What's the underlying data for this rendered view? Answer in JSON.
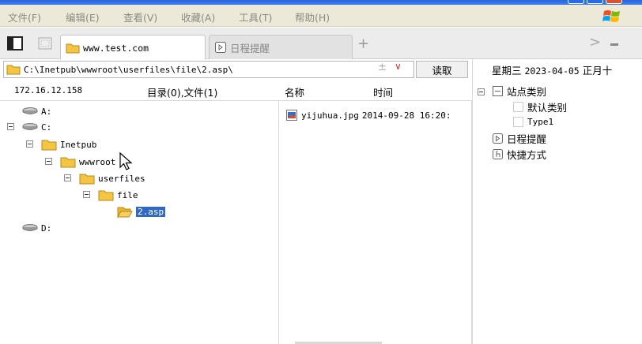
{
  "menu": {
    "items": [
      "文件(F)",
      "编辑(E)",
      "查看(V)",
      "收藏(A)",
      "工具(T)",
      "帮助(H)"
    ]
  },
  "tabs": [
    {
      "label": "www.test.com",
      "icon": "folder-icon",
      "active": true
    },
    {
      "label": "日程提醒",
      "icon": "calendar-icon",
      "active": false
    }
  ],
  "tab_add": "+",
  "address": {
    "path": "C:\\Inetpub\\wwwroot\\userfiles\\file\\2.asp\\",
    "plusminus": "±",
    "dropdown": "∨",
    "read_button": "读取"
  },
  "status": {
    "ip": "172.16.12.158",
    "summary": "目录(0),文件(1)"
  },
  "columns": {
    "name": "名称",
    "time": "时间"
  },
  "tree": [
    {
      "label": "A:",
      "type": "drive"
    },
    {
      "label": "C:",
      "type": "drive"
    },
    {
      "label": "Inetpub",
      "type": "folder"
    },
    {
      "label": "wwwroot",
      "type": "folder"
    },
    {
      "label": "userfiles",
      "type": "folder"
    },
    {
      "label": "file",
      "type": "folder"
    },
    {
      "label": "2.asp",
      "type": "folder-open",
      "selected": true
    },
    {
      "label": "D:",
      "type": "drive"
    }
  ],
  "files": [
    {
      "name": "yijuhua.jpg",
      "time": "2014-09-28 16:20:"
    }
  ],
  "right_panel": {
    "date_weekday": "星期三",
    "date_value": "2023-04-05",
    "date_lunar": "正月十",
    "nodes": [
      {
        "label": "站点类别",
        "icon": "category-icon"
      },
      {
        "label": "默认类别",
        "icon": "dotted-box-icon"
      },
      {
        "label": "Type1",
        "icon": "dotted-box-icon"
      },
      {
        "label": "日程提醒",
        "icon": "calendar-icon"
      },
      {
        "label": "快捷方式",
        "icon": "shortcut-icon"
      }
    ]
  },
  "colors": {
    "selection": "#316ac5",
    "folder": "#f5c542",
    "menu_text": "#8c8a84",
    "dropdown_red": "#dd3333"
  }
}
